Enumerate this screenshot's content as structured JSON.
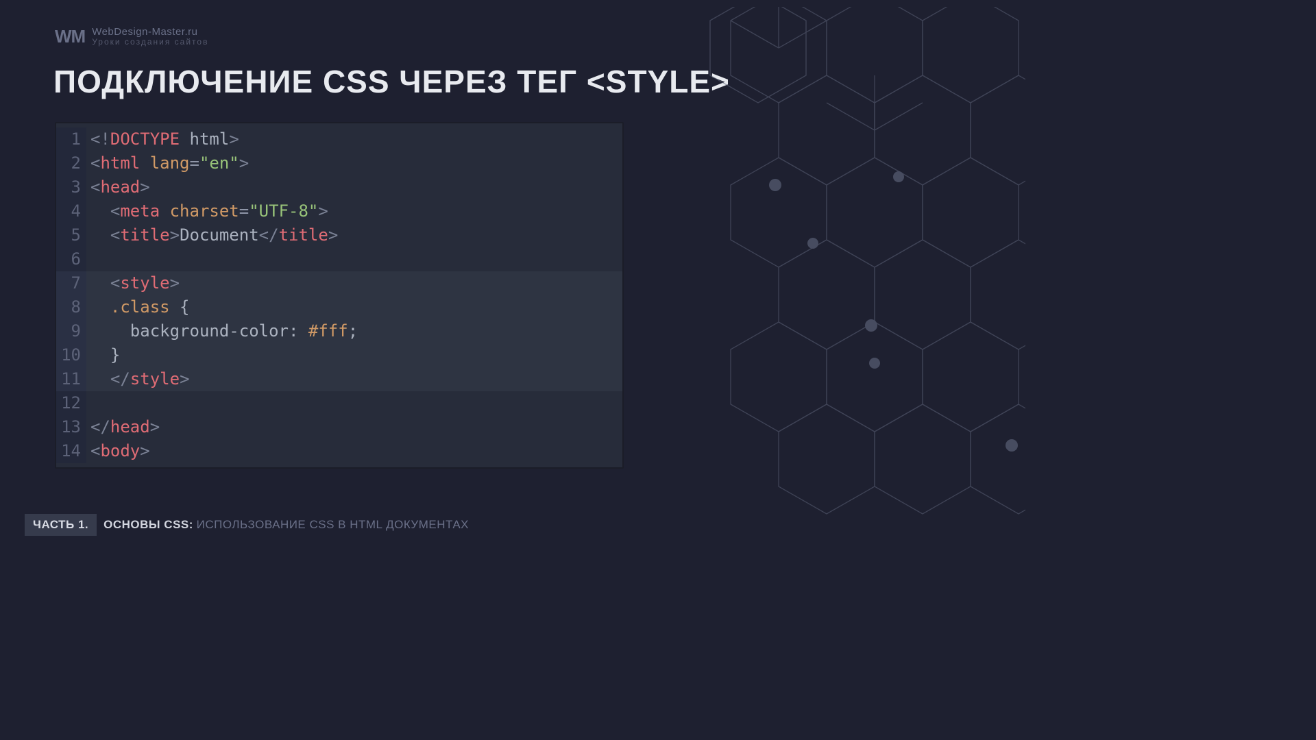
{
  "brand": {
    "mark": "WM",
    "title": "WebDesign-Master.ru",
    "subtitle": "Уроки создания сайтов"
  },
  "slide_title": "ПОДКЛЮЧЕНИЕ CSS ЧЕРЕЗ ТЕГ <STYLE>",
  "footer": {
    "badge": "ЧАСТЬ 1.",
    "strong": "ОСНОВЫ CSS:",
    "rest": "ИСПОЛЬЗОВАНИЕ CSS В HTML ДОКУМЕНТАХ"
  },
  "code": {
    "highlight_start": 7,
    "highlight_end": 11,
    "lines": [
      {
        "n": 1,
        "tokens": [
          {
            "t": "<!",
            "c": "c-angle"
          },
          {
            "t": "DOCTYPE",
            "c": "c-doctype"
          },
          {
            "t": " html",
            "c": "c-text"
          },
          {
            "t": ">",
            "c": "c-angle"
          }
        ]
      },
      {
        "n": 2,
        "tokens": [
          {
            "t": "<",
            "c": "c-angle"
          },
          {
            "t": "html",
            "c": "c-tag"
          },
          {
            "t": " ",
            "c": "c-text"
          },
          {
            "t": "lang",
            "c": "c-attr"
          },
          {
            "t": "=",
            "c": "c-eq"
          },
          {
            "t": "\"en\"",
            "c": "c-str"
          },
          {
            "t": ">",
            "c": "c-angle"
          }
        ]
      },
      {
        "n": 3,
        "tokens": [
          {
            "t": "<",
            "c": "c-angle"
          },
          {
            "t": "head",
            "c": "c-tag"
          },
          {
            "t": ">",
            "c": "c-angle"
          }
        ]
      },
      {
        "n": 4,
        "tokens": [
          {
            "t": "  ",
            "c": "c-text"
          },
          {
            "t": "<",
            "c": "c-angle"
          },
          {
            "t": "meta",
            "c": "c-tag"
          },
          {
            "t": " ",
            "c": "c-text"
          },
          {
            "t": "charset",
            "c": "c-attr"
          },
          {
            "t": "=",
            "c": "c-eq"
          },
          {
            "t": "\"UTF-8\"",
            "c": "c-str"
          },
          {
            "t": ">",
            "c": "c-angle"
          }
        ]
      },
      {
        "n": 5,
        "tokens": [
          {
            "t": "  ",
            "c": "c-text"
          },
          {
            "t": "<",
            "c": "c-angle"
          },
          {
            "t": "title",
            "c": "c-tag"
          },
          {
            "t": ">",
            "c": "c-angle"
          },
          {
            "t": "Document",
            "c": "c-text"
          },
          {
            "t": "</",
            "c": "c-angle"
          },
          {
            "t": "title",
            "c": "c-tag"
          },
          {
            "t": ">",
            "c": "c-angle"
          }
        ]
      },
      {
        "n": 6,
        "tokens": [
          {
            "t": " ",
            "c": "c-text"
          }
        ]
      },
      {
        "n": 7,
        "tokens": [
          {
            "t": "  ",
            "c": "c-text"
          },
          {
            "t": "<",
            "c": "c-angle"
          },
          {
            "t": "style",
            "c": "c-tag"
          },
          {
            "t": ">",
            "c": "c-angle"
          }
        ]
      },
      {
        "n": 8,
        "tokens": [
          {
            "t": "  ",
            "c": "c-text"
          },
          {
            "t": ".class",
            "c": "c-sel"
          },
          {
            "t": " {",
            "c": "c-brace"
          }
        ]
      },
      {
        "n": 9,
        "tokens": [
          {
            "t": "    ",
            "c": "c-text"
          },
          {
            "t": "background-color",
            "c": "c-prop"
          },
          {
            "t": ": ",
            "c": "c-punct"
          },
          {
            "t": "#fff",
            "c": "c-val"
          },
          {
            "t": ";",
            "c": "c-punct"
          }
        ]
      },
      {
        "n": 10,
        "tokens": [
          {
            "t": "  ",
            "c": "c-text"
          },
          {
            "t": "}",
            "c": "c-brace"
          }
        ]
      },
      {
        "n": 11,
        "tokens": [
          {
            "t": "  ",
            "c": "c-text"
          },
          {
            "t": "</",
            "c": "c-angle"
          },
          {
            "t": "style",
            "c": "c-tag"
          },
          {
            "t": ">",
            "c": "c-angle"
          }
        ]
      },
      {
        "n": 12,
        "tokens": [
          {
            "t": " ",
            "c": "c-text"
          }
        ]
      },
      {
        "n": 13,
        "tokens": [
          {
            "t": "</",
            "c": "c-angle"
          },
          {
            "t": "head",
            "c": "c-tag"
          },
          {
            "t": ">",
            "c": "c-angle"
          }
        ]
      },
      {
        "n": 14,
        "tokens": [
          {
            "t": "<",
            "c": "c-angle"
          },
          {
            "t": "body",
            "c": "c-tag"
          },
          {
            "t": ">",
            "c": "c-angle"
          }
        ]
      }
    ]
  }
}
